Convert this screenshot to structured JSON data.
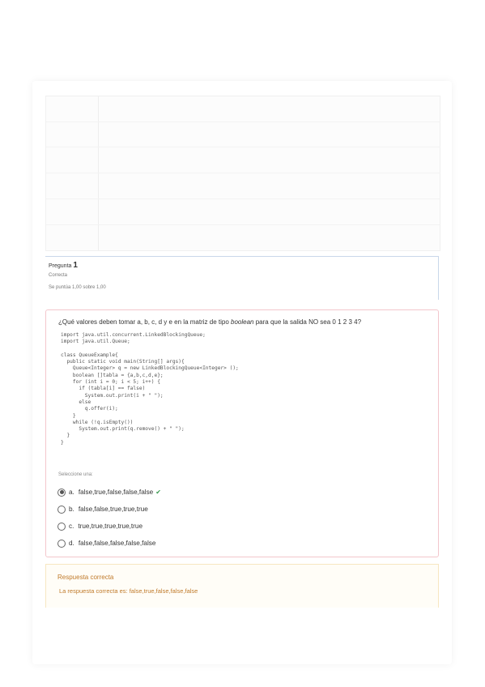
{
  "question_info": {
    "label": "Pregunta",
    "number": "1",
    "state": "Correcta",
    "score": "Se puntúa 1,00 sobre 1,00"
  },
  "question": {
    "text_before": "¿Qué valores deben tomar a, b, c, d y e en la matriz de tipo ",
    "text_emph": "boolean",
    "text_after": " para que la salida NO sea 0 1 2 3 4?",
    "code": "import java.util.concurrent.LinkedBlockingQueue;\nimport java.util.Queue;\n\nclass QueueExample{\n  public static void main(String[] args){\n    Queue<Integer> q = new LinkedBlockingQueue<Integer> ();\n    boolean []tabla = {a,b,c,d,e};\n    for (int i = 0; i < 5; i++) {\n      if (tabla[i] == false)\n        System.out.print(i + \" \");\n      else\n        q.offer(i);\n    }\n    while (!q.isEmpty())\n      System.out.print(q.remove() + \" \");\n  }\n}",
    "select_label": "Seleccione una:",
    "options": [
      {
        "letter": "a.",
        "text": "false,true,false,false,false",
        "checked": true,
        "correct": true
      },
      {
        "letter": "b.",
        "text": "false,false,true,true,true",
        "checked": false
      },
      {
        "letter": "c.",
        "text": "true,true,true,true,true",
        "checked": false
      },
      {
        "letter": "d.",
        "text": "false,false,false,false,false",
        "checked": false
      }
    ],
    "check_icon": "✔"
  },
  "feedback": {
    "title": "Respuesta correcta",
    "text": "La respuesta correcta es: false,true,false,false,false"
  },
  "colors": {
    "question_border": "#f3c6cc",
    "feedback_text": "#c07a2a",
    "check": "#3c9a52"
  }
}
